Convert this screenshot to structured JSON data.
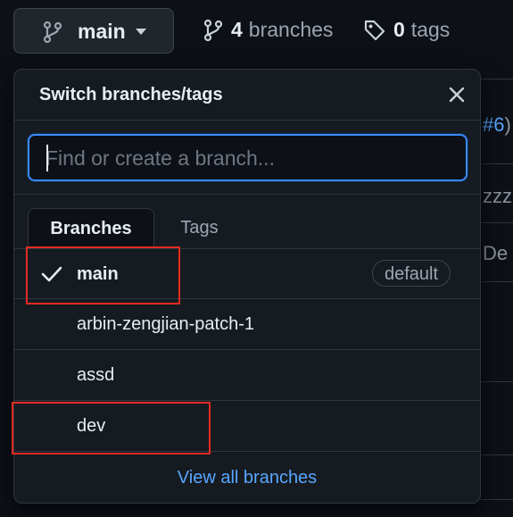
{
  "top_bar": {
    "current_branch": "main",
    "branch_count": "4",
    "branches_label": "branches",
    "tag_count": "0",
    "tags_label": "tags"
  },
  "background": {
    "issue_ref_link": "#6",
    "issue_ref_suffix": ")",
    "commit_text": "zzz",
    "desc_text": "De"
  },
  "dropdown": {
    "title": "Switch branches/tags",
    "search_placeholder": "Find or create a branch...",
    "tabs": [
      {
        "label": "Branches",
        "active": true
      },
      {
        "label": "Tags",
        "active": false
      }
    ],
    "branches": [
      {
        "name": "main",
        "selected": true,
        "badge": "default"
      },
      {
        "name": "arbin-zengjian-patch-1",
        "selected": false
      },
      {
        "name": "assd",
        "selected": false
      },
      {
        "name": "dev",
        "selected": false
      }
    ],
    "view_all_label": "View all branches"
  },
  "colors": {
    "background": "#0d1117",
    "panel": "#161b22",
    "accent_link": "#58a6ff",
    "focus_border": "#388bfd",
    "annotation": "#e32b22"
  },
  "icons": [
    "git-branch-icon",
    "caret-down-icon",
    "tag-icon",
    "close-icon",
    "check-icon"
  ]
}
